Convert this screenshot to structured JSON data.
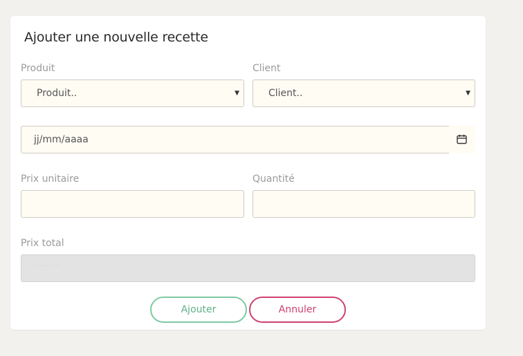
{
  "form": {
    "title": "Ajouter une nouvelle recette",
    "produit": {
      "label": "Produit",
      "selected": "Produit.."
    },
    "client": {
      "label": "Client",
      "selected": "Client.."
    },
    "date": {
      "placeholder": "jj/mm/aaaa",
      "icon": "calendar-icon"
    },
    "prix_unitaire": {
      "label": "Prix unitaire",
      "value": ""
    },
    "quantite": {
      "label": "Quantité",
      "value": ""
    },
    "prix_total": {
      "label": "Prix total",
      "value": "·········"
    },
    "buttons": {
      "add": "Ajouter",
      "cancel": "Annuler"
    }
  },
  "colors": {
    "background": "#f2f1ee",
    "field_bg": "#fffcf4",
    "disabled_bg": "#e3e3e3",
    "add_accent": "#7dc9a2",
    "cancel_accent": "#d0406e"
  }
}
